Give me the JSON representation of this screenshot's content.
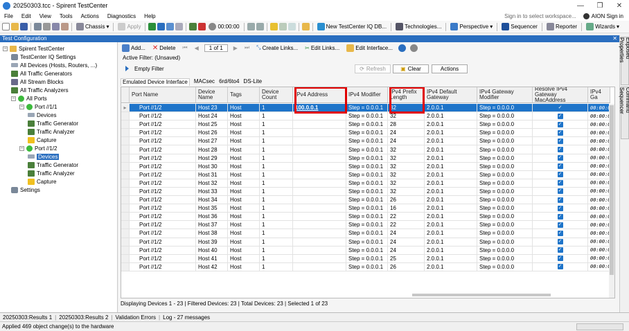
{
  "window": {
    "title": "20250303.tcc - Spirent TestCenter"
  },
  "menu": {
    "items": [
      "File",
      "Edit",
      "View",
      "Tools",
      "Actions",
      "Diagnostics",
      "Help"
    ],
    "signin": "Sign in to select workspace...",
    "user": "AION Sign in"
  },
  "toolbar": {
    "chassis": "Chassis",
    "apply": "Apply",
    "timer": "00:00:00",
    "new_db": "New TestCenter IQ DB...",
    "technologies": "Technologies...",
    "perspective": "Perspective",
    "sequencer": "Sequencer",
    "reporter": "Reporter",
    "wizards": "Wizards"
  },
  "panel": {
    "title": "Test Configuration"
  },
  "tree": [
    {
      "label": "Spirent TestCenter",
      "icon": "folder-icon",
      "indent": 0,
      "exp": "−"
    },
    {
      "label": "TestCenter IQ Settings",
      "icon": "gear-icon",
      "indent": 1
    },
    {
      "label": "All Devices (Hosts, Routers, ...)",
      "icon": "device-icon",
      "indent": 1
    },
    {
      "label": "All Traffic Generators",
      "icon": "generator-icon",
      "indent": 1
    },
    {
      "label": "All Stream Blocks",
      "icon": "stream-icon",
      "indent": 1
    },
    {
      "label": "All Traffic Analyzers",
      "icon": "generator-icon",
      "indent": 1
    },
    {
      "label": "All Ports",
      "icon": "port-icon",
      "indent": 1,
      "exp": "−"
    },
    {
      "label": "Port //1/1",
      "icon": "port-icon",
      "indent": 2,
      "exp": "−"
    },
    {
      "label": "Devices",
      "icon": "device-icon",
      "indent": 3
    },
    {
      "label": "Traffic Generator",
      "icon": "generator-icon",
      "indent": 3
    },
    {
      "label": "Traffic Analyzer",
      "icon": "generator-icon",
      "indent": 3
    },
    {
      "label": "Capture",
      "icon": "capture-icon",
      "indent": 3
    },
    {
      "label": "Port //1/2",
      "icon": "port-icon",
      "indent": 2,
      "exp": "−"
    },
    {
      "label": "Devices",
      "icon": "device-icon",
      "indent": 3,
      "selected": true
    },
    {
      "label": "Traffic Generator",
      "icon": "generator-icon",
      "indent": 3
    },
    {
      "label": "Traffic Analyzer",
      "icon": "generator-icon",
      "indent": 3
    },
    {
      "label": "Capture",
      "icon": "capture-icon",
      "indent": 3
    },
    {
      "label": "Settings",
      "icon": "gear-icon",
      "indent": 1
    }
  ],
  "content_toolbar": {
    "add": "Add...",
    "delete": "Delete",
    "page": "1 of 1",
    "create_links": "Create Links...",
    "edit_links": "Edit Links...",
    "edit_interface": "Edit Interface..."
  },
  "filter": {
    "label": "Active Filter: (Unsaved)",
    "empty": "Empty Filter",
    "refresh": "Refresh",
    "clear": "Clear",
    "actions": "Actions"
  },
  "sub_tabs": [
    "Emulated Device Interface",
    "MACsec",
    "6rd/6to4",
    "DS-Lite"
  ],
  "grid": {
    "headers": [
      "Port Name",
      "Device Name",
      "Tags",
      "Device Count",
      "IPv4 Address",
      "IPv4 Modifier",
      "IPv4 Prefix Length",
      "IPv4 Default Gateway",
      "IPv4 Gateway Modifier",
      "Resolve IPv4 Gateway MacAddress",
      "IPv4 Ga"
    ],
    "rows": [
      {
        "port": "Port //1/2",
        "name": "Host 23",
        "tags": "Host",
        "count": "1",
        "addr": "100.0.0.1",
        "mod": "Step = 0.0.0.1",
        "prefix": "32",
        "gw": "2.0.0.1",
        "gwmod": "Step = 0.0.0.0",
        "resolve": "✓",
        "gax": "00:00:0",
        "selected": true
      },
      {
        "port": "Port //1/2",
        "name": "Host 24",
        "tags": "Host",
        "count": "1",
        "addr": "",
        "mod": "Step = 0.0.0.1",
        "prefix": "32",
        "gw": "2.0.0.1",
        "gwmod": "Step = 0.0.0.0",
        "resolve": "✓",
        "gax": "00:00:0"
      },
      {
        "port": "Port //1/2",
        "name": "Host 25",
        "tags": "Host",
        "count": "1",
        "addr": "",
        "mod": "Step = 0.0.0.1",
        "prefix": "28",
        "gw": "2.0.0.1",
        "gwmod": "Step = 0.0.0.0",
        "resolve": "✓",
        "gax": "00:00:0"
      },
      {
        "port": "Port //1/2",
        "name": "Host 26",
        "tags": "Host",
        "count": "1",
        "addr": "",
        "mod": "Step = 0.0.0.1",
        "prefix": "24",
        "gw": "2.0.0.1",
        "gwmod": "Step = 0.0.0.0",
        "resolve": "✓",
        "gax": "00:00:0"
      },
      {
        "port": "Port //1/2",
        "name": "Host 27",
        "tags": "Host",
        "count": "1",
        "addr": "",
        "mod": "Step = 0.0.0.1",
        "prefix": "24",
        "gw": "2.0.0.1",
        "gwmod": "Step = 0.0.0.0",
        "resolve": "✓",
        "gax": "00:00:0"
      },
      {
        "port": "Port //1/2",
        "name": "Host 28",
        "tags": "Host",
        "count": "1",
        "addr": "",
        "mod": "Step = 0.0.0.1",
        "prefix": "32",
        "gw": "2.0.0.1",
        "gwmod": "Step = 0.0.0.0",
        "resolve": "✓",
        "gax": "00:00:0"
      },
      {
        "port": "Port //1/2",
        "name": "Host 29",
        "tags": "Host",
        "count": "1",
        "addr": "",
        "mod": "Step = 0.0.0.1",
        "prefix": "32",
        "gw": "2.0.0.1",
        "gwmod": "Step = 0.0.0.0",
        "resolve": "✓",
        "gax": "00:00:0"
      },
      {
        "port": "Port //1/2",
        "name": "Host 30",
        "tags": "Host",
        "count": "1",
        "addr": "",
        "mod": "Step = 0.0.0.1",
        "prefix": "32",
        "gw": "2.0.0.1",
        "gwmod": "Step = 0.0.0.0",
        "resolve": "✓",
        "gax": "00:00:0"
      },
      {
        "port": "Port //1/2",
        "name": "Host 31",
        "tags": "Host",
        "count": "1",
        "addr": "",
        "mod": "Step = 0.0.0.1",
        "prefix": "32",
        "gw": "2.0.0.1",
        "gwmod": "Step = 0.0.0.0",
        "resolve": "✓",
        "gax": "00:00:0"
      },
      {
        "port": "Port //1/2",
        "name": "Host 32",
        "tags": "Host",
        "count": "1",
        "addr": "",
        "mod": "Step = 0.0.0.1",
        "prefix": "32",
        "gw": "2.0.0.1",
        "gwmod": "Step = 0.0.0.0",
        "resolve": "✓",
        "gax": "00:00:0"
      },
      {
        "port": "Port //1/2",
        "name": "Host 33",
        "tags": "Host",
        "count": "1",
        "addr": "",
        "mod": "Step = 0.0.0.1",
        "prefix": "32",
        "gw": "2.0.0.1",
        "gwmod": "Step = 0.0.0.0",
        "resolve": "✓",
        "gax": "00:00:0"
      },
      {
        "port": "Port //1/2",
        "name": "Host 34",
        "tags": "Host",
        "count": "1",
        "addr": "",
        "mod": "Step = 0.0.0.1",
        "prefix": "26",
        "gw": "2.0.0.1",
        "gwmod": "Step = 0.0.0.0",
        "resolve": "✓",
        "gax": "00:00:0"
      },
      {
        "port": "Port //1/2",
        "name": "Host 35",
        "tags": "Host",
        "count": "1",
        "addr": "",
        "mod": "Step = 0.0.0.1",
        "prefix": "16",
        "gw": "2.0.0.1",
        "gwmod": "Step = 0.0.0.0",
        "resolve": "✓",
        "gax": "00:00:0"
      },
      {
        "port": "Port //1/2",
        "name": "Host 36",
        "tags": "Host",
        "count": "1",
        "addr": "",
        "mod": "Step = 0.0.0.1",
        "prefix": "22",
        "gw": "2.0.0.1",
        "gwmod": "Step = 0.0.0.0",
        "resolve": "✓",
        "gax": "00:00:0"
      },
      {
        "port": "Port //1/2",
        "name": "Host 37",
        "tags": "Host",
        "count": "1",
        "addr": "",
        "mod": "Step = 0.0.0.1",
        "prefix": "22",
        "gw": "2.0.0.1",
        "gwmod": "Step = 0.0.0.0",
        "resolve": "✓",
        "gax": "00:00:0"
      },
      {
        "port": "Port //1/2",
        "name": "Host 38",
        "tags": "Host",
        "count": "1",
        "addr": "",
        "mod": "Step = 0.0.0.1",
        "prefix": "24",
        "gw": "2.0.0.1",
        "gwmod": "Step = 0.0.0.0",
        "resolve": "✓",
        "gax": "00:00:0"
      },
      {
        "port": "Port //1/2",
        "name": "Host 39",
        "tags": "Host",
        "count": "1",
        "addr": "",
        "mod": "Step = 0.0.0.1",
        "prefix": "24",
        "gw": "2.0.0.1",
        "gwmod": "Step = 0.0.0.0",
        "resolve": "✓",
        "gax": "00:00:0"
      },
      {
        "port": "Port //1/2",
        "name": "Host 40",
        "tags": "Host",
        "count": "1",
        "addr": "",
        "mod": "Step = 0.0.0.1",
        "prefix": "24",
        "gw": "2.0.0.1",
        "gwmod": "Step = 0.0.0.0",
        "resolve": "✓",
        "gax": "00:00:0"
      },
      {
        "port": "Port //1/2",
        "name": "Host 41",
        "tags": "Host",
        "count": "1",
        "addr": "",
        "mod": "Step = 0.0.0.1",
        "prefix": "25",
        "gw": "2.0.0.1",
        "gwmod": "Step = 0.0.0.0",
        "resolve": "✓",
        "gax": "00:00:0"
      },
      {
        "port": "Port //1/2",
        "name": "Host 42",
        "tags": "Host",
        "count": "1",
        "addr": "",
        "mod": "Step = 0.0.0.1",
        "prefix": "26",
        "gw": "2.0.0.1",
        "gwmod": "Step = 0.0.0.0",
        "resolve": "✓",
        "gax": "00:00:0"
      }
    ]
  },
  "status_line": "Displaying Devices 1 - 23  |  Filtered Devices: 23  |  Total Devices: 23  |  Selected 1 of 23",
  "right_tabs": [
    "Exposed Properties",
    "Command Sequencer"
  ],
  "bottom_tabs": [
    "20250303:Results 1",
    "20250303:Results 2",
    "Validation Errors",
    "Log - 27 messages"
  ],
  "status_bar": "Applied 469 object change(s) to the hardware",
  "colors": {
    "accent": "#2a6ebf",
    "selection": "#1e74c9",
    "highlight": "#e00000"
  }
}
